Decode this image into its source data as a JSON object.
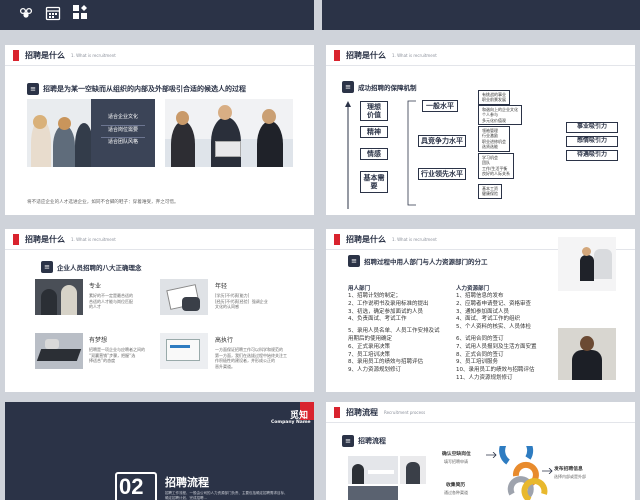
{
  "top": {
    "icons": [
      "people-group-icon",
      "calendar-icon",
      "grid-icon"
    ]
  },
  "slide1": {
    "title": "招聘是什么",
    "subtitle": "1. What is recruitment",
    "heading": "招聘是为某一空缺而从组织的内部及外部吸引合适的候选人的过程",
    "panel_items": [
      "适合企业文化",
      "适合岗位需要",
      "适合团队风格"
    ],
    "footer": "将不适应企业的人才选进企业，如同不合脚的鞋子：穿着难受，弃之可惜。"
  },
  "slide2": {
    "title": "招聘是什么",
    "subtitle": "1. What is recruitment",
    "heading": "成功招聘的保障机制",
    "left_boxes": [
      "理想\n价值",
      "精神",
      "情感",
      "基本需\n要"
    ],
    "mid_boxes": [
      "一般水平",
      "具竞争力水平",
      "行业领先水平"
    ],
    "list1": [
      "有挑战的事业",
      "职业前景发展"
    ],
    "list2": [
      "和谐向上的企业文化",
      "个人参与",
      "多元化价值观"
    ],
    "list3": [
      "领袖管理",
      "行业激励",
      "职业进修机会",
      "选贤选能"
    ],
    "list4": [
      "学习机会",
      "团队",
      "工作/生活平衡",
      "良好的人际关系"
    ],
    "list5": [
      "基本工资",
      "健康保险"
    ],
    "right_boxes": [
      "事业吸引力",
      "感情吸引力",
      "待遇吸引力"
    ]
  },
  "slide3": {
    "title": "招聘是什么",
    "subtitle": "1. What is recruitment",
    "heading": "企业人员招聘的八大正确理念",
    "items": [
      {
        "label": "专业",
        "desc": "素好的不一定是最合适的\n合适的人才能与岗位匹配\n的人才"
      },
      {
        "label": "年轻",
        "desc": "[学历]不代表[能力]\n[经历]不代表[经验]  强调企业\n文化的认同感"
      },
      {
        "label": "有梦想",
        "desc": "招聘是一项企业与应聘者之间的\n“双赢营销”步骤，把握“选\n择适合”的态度"
      },
      {
        "label": "高执行",
        "desc": "一方面保证招聘工作可以科学和规范的\n第一方面，我们在选拔过程中始终关注工\n作积极性的建设者，并形成公正的\n晋升渠道。"
      }
    ]
  },
  "slide4": {
    "title": "招聘是什么",
    "subtitle": "1. What is recruitment",
    "heading": "招聘过程中用人部门与人力资源部门的分工",
    "col1_title": "用人部门",
    "col1": [
      "1、招聘计划的制定；",
      "2、工作说明书及录用标准的提出",
      "3、初选，确定参加面试的人员",
      "4、负责面试、考试工作",
      "",
      "5、录用人员名单、人员工作安排及试",
      "用期后的使用确定",
      "6、正式录用决策",
      "7、员工培训决策",
      "8、录用员工的绩效与招聘评估",
      "9、人力资源规划修订"
    ],
    "col2_title": "人力资源部门",
    "col2": [
      "1、招聘信息的发布",
      "2、应聘者申请登记、资格审查",
      "3、通知参加面试人员",
      "4、面试、考试工作的组织",
      "5、个人资料的核实、人员体检",
      "",
      "6、试用合同的签订",
      "7、试用人员报到及生活方面安置",
      "8、正式合同的签订",
      "9、员工培训服务",
      "10、录用员工的绩效与招聘评估",
      "11、人力资源规划修订"
    ]
  },
  "slide5": {
    "brand": "觅知",
    "brand_sub": "Company Name",
    "number": "02",
    "title": "招聘流程",
    "desc": "招聘工作流程、一般由公司的人力资源部门负责、主要包括确定招聘需求目标、\n确定招聘计划、完成招聘..."
  },
  "slide6": {
    "title": "招聘流程",
    "subtitle": "Recruitment process",
    "heading": "招聘流程",
    "steps": [
      {
        "title": "确认空缺岗位",
        "sub": "填写招聘申请"
      },
      {
        "title": "发布招聘信息",
        "sub": "选择内部或是外部"
      },
      {
        "title": "收集简历",
        "sub": "通过各种渠道"
      }
    ],
    "colors": {
      "blue": "#2e7cc1",
      "orange": "#e88b2d",
      "gray": "#9ea3ad",
      "yellow": "#e8b82d"
    }
  }
}
